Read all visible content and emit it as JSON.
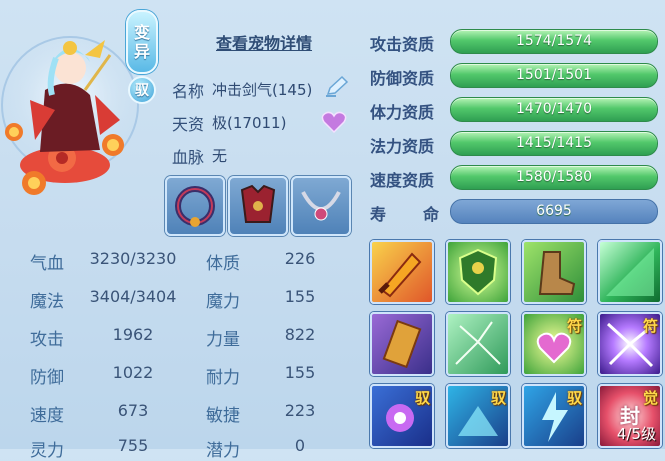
{
  "badges": {
    "mutate_1": "变",
    "mutate_2": "异",
    "ride": "驭"
  },
  "detail_link": "查看宠物详情",
  "info": {
    "name_label": "名称",
    "name_value": "冲击剑气(145)",
    "talent_label": "天资",
    "talent_value": "极(17011)",
    "bloodline_label": "血脉",
    "bloodline_value": "无"
  },
  "stats": [
    {
      "l1": "气血",
      "v1": "3230/3230",
      "l2": "体质",
      "v2": "226"
    },
    {
      "l1": "魔法",
      "v1": "3404/3404",
      "l2": "魔力",
      "v2": "155"
    },
    {
      "l1": "攻击",
      "v1": "1962",
      "l2": "力量",
      "v2": "822"
    },
    {
      "l1": "防御",
      "v1": "1022",
      "l2": "耐力",
      "v2": "155"
    },
    {
      "l1": "速度",
      "v1": "673",
      "l2": "敏捷",
      "v2": "223"
    },
    {
      "l1": "灵力",
      "v1": "755",
      "l2": "潜力",
      "v2": "0"
    }
  ],
  "aptitudes": [
    {
      "label": "攻击资质",
      "value": "1574/1574"
    },
    {
      "label": "防御资质",
      "value": "1501/1501"
    },
    {
      "label": "体力资质",
      "value": "1470/1470"
    },
    {
      "label": "法力资质",
      "value": "1415/1415"
    },
    {
      "label": "速度资质",
      "value": "1580/1580"
    }
  ],
  "life": {
    "label_1": "寿",
    "label_2": "命",
    "value": "6695"
  },
  "skills": {
    "tag_fu": "符",
    "tag_yu": "驭",
    "tag_jue": "觉",
    "tag_feng": "封",
    "level": "4/5级"
  },
  "colors": {
    "accent_green": "#3fb35e",
    "panel_blue": "#c6dcef",
    "tag_gold": "#ffd84a"
  }
}
